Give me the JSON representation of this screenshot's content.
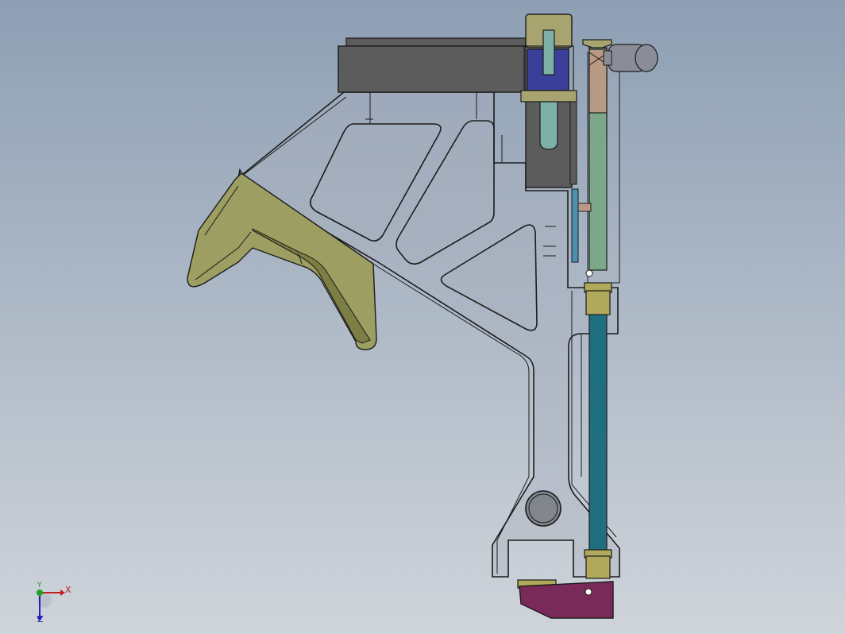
{
  "viewport": {
    "name": "cad-graphics-viewport",
    "background_top": "#8e9fb4",
    "background_bottom": "#cfd4da"
  },
  "model": {
    "colors": {
      "frame_plate": "#a8b0bc",
      "frame_edge": "#1c1c1c",
      "clamp_jaw": "#9c9e62",
      "clamp_jaw_dark": "#7c7e44",
      "housing_block": "#5c5c5c",
      "slider_block": "#3a3f9a",
      "pin": "#7fb0a8",
      "top_collar": "#a8a470",
      "vertical_rod_upper": "#7aa888",
      "rod_sleeve": "#b89a84",
      "roller": "#8a8d98",
      "bushing": "#b0a85a",
      "lower_shaft": "#1f6f80",
      "base_bracket": "#7a2a58",
      "small_plate": "#4c8fb0"
    }
  },
  "triad": {
    "x_label": "X",
    "y_label": "Y",
    "z_label": "Z",
    "x_color": "#c02020",
    "y_color": "#20a020",
    "z_color": "#2020c0"
  }
}
